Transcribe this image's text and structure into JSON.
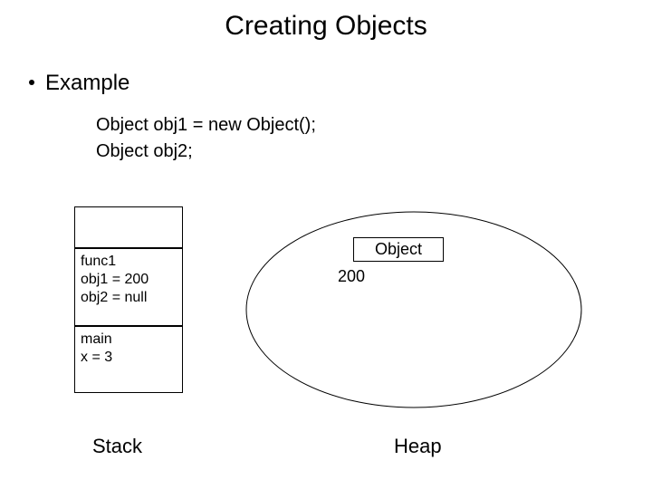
{
  "title": "Creating Objects",
  "bullet": "Example",
  "code": {
    "line1": "Object obj1 = new Object();",
    "line2": "Object obj2;"
  },
  "stack": {
    "label": "Stack",
    "frame_func": {
      "name": "func1",
      "var1": "obj1 = 200",
      "var2": "obj2 = null"
    },
    "frame_main": {
      "name": "main",
      "var1": "x = 3"
    }
  },
  "heap": {
    "label": "Heap",
    "object_label": "Object",
    "address": "200"
  }
}
